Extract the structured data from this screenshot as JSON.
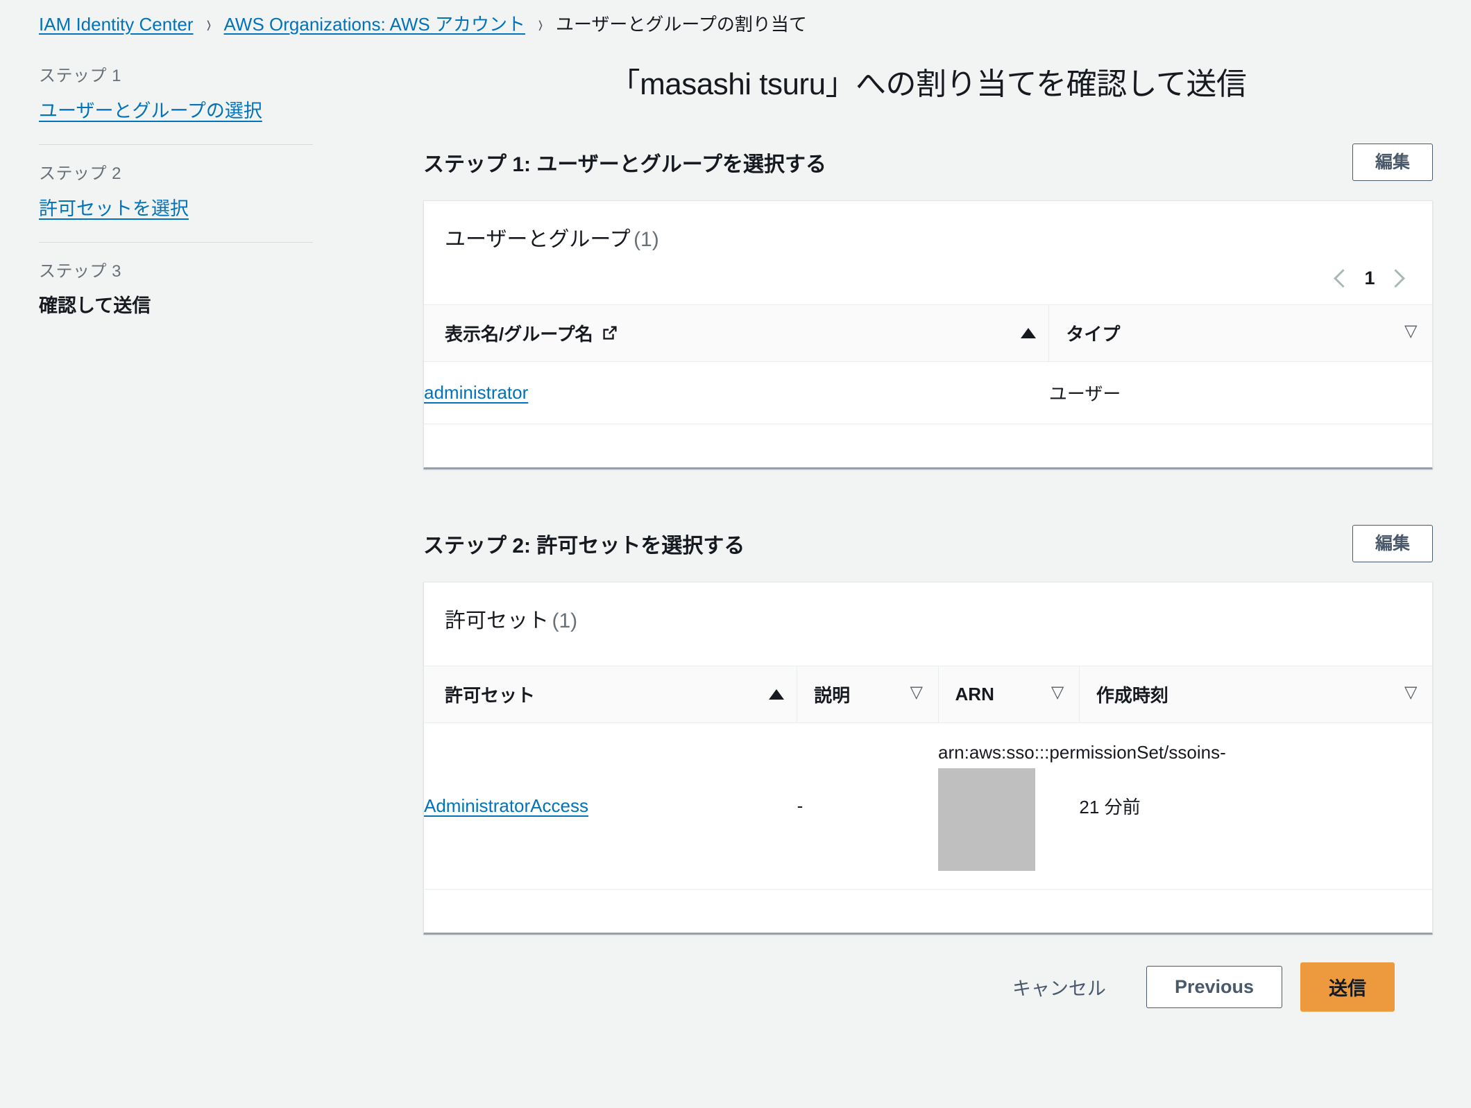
{
  "breadcrumb": {
    "items": [
      {
        "label": "IAM Identity Center",
        "type": "link"
      },
      {
        "label": "AWS Organizations: AWS アカウント",
        "type": "link"
      },
      {
        "label": "ユーザーとグループの割り当て",
        "type": "current"
      }
    ],
    "separator": "›"
  },
  "stepnav": {
    "steps": [
      {
        "kicker": "ステップ 1",
        "label": "ユーザーとグループの選択",
        "state": "link"
      },
      {
        "kicker": "ステップ 2",
        "label": "許可セットを選択",
        "state": "link"
      },
      {
        "kicker": "ステップ 3",
        "label": "確認して送信",
        "state": "current"
      }
    ]
  },
  "main": {
    "page_title": "「masashi tsuru」への割り当てを確認して送信",
    "section1": {
      "title": "ステップ 1: ユーザーとグループを選択する",
      "edit_label": "編集",
      "card": {
        "title": "ユーザーとグループ",
        "count": "(1)",
        "pager": {
          "page": "1"
        },
        "columns": [
          {
            "label": "表示名/グループ名",
            "sort": "asc",
            "icon": "external-link-icon"
          },
          {
            "label": "タイプ",
            "sort": "none"
          }
        ],
        "rows": [
          {
            "name": "administrator",
            "type": "ユーザー"
          }
        ]
      }
    },
    "section2": {
      "title": "ステップ 2: 許可セットを選択する",
      "edit_label": "編集",
      "card": {
        "title": "許可セット",
        "count": "(1)",
        "columns": [
          {
            "label": "許可セット",
            "sort": "asc"
          },
          {
            "label": "説明",
            "sort": "none"
          },
          {
            "label": "ARN",
            "sort": "none"
          },
          {
            "label": "作成時刻",
            "sort": "none"
          }
        ],
        "rows": [
          {
            "name": "AdministratorAccess",
            "description": "-",
            "arn": "arn:aws:sso:::permissionSet/ssoins-",
            "arn_redacted": true,
            "created": "21 分前"
          }
        ]
      }
    }
  },
  "footer": {
    "cancel_label": "キャンセル",
    "previous_label": "Previous",
    "submit_label": "送信"
  },
  "colors": {
    "page_bg": "#f2f3f3",
    "link": "#0073bb",
    "primary_button": "#ec9a3d",
    "secondary_border": "#49586b",
    "muted_text": "#687078",
    "redaction": "#bfbfbf"
  }
}
